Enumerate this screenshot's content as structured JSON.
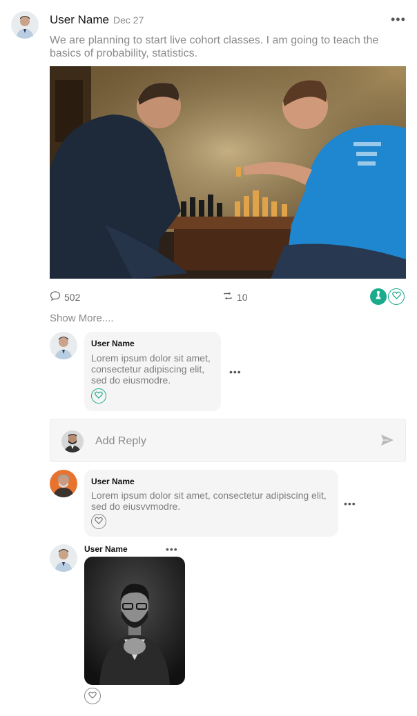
{
  "post": {
    "author": "User Name",
    "date": "Dec 27",
    "text": "We are planning to start live cohort classes. I am going to teach the basics of probability, statistics.",
    "comments_count": "502",
    "reposts_count": "10",
    "show_more": "Show More...."
  },
  "comments": [
    {
      "author": "User Name",
      "text": "Lorem ipsum dolor sit amet, consectetur adipiscing elit, sed do eiusmodre."
    },
    {
      "author": "User Name",
      "text": "Lorem ipsum dolor sit amet, consectetur adipiscing elit, sed do eiusvvmodre."
    },
    {
      "author": "User Name"
    }
  ],
  "reply": {
    "placeholder": "Add Reply"
  },
  "colors": {
    "accent": "#1aaa8c",
    "text_muted": "#8a8a8a",
    "bubble_bg": "#f5f5f5"
  },
  "icons": [
    "more-icon",
    "comment-icon",
    "repost-icon",
    "chess-pawn-icon",
    "heart-icon",
    "send-icon"
  ]
}
